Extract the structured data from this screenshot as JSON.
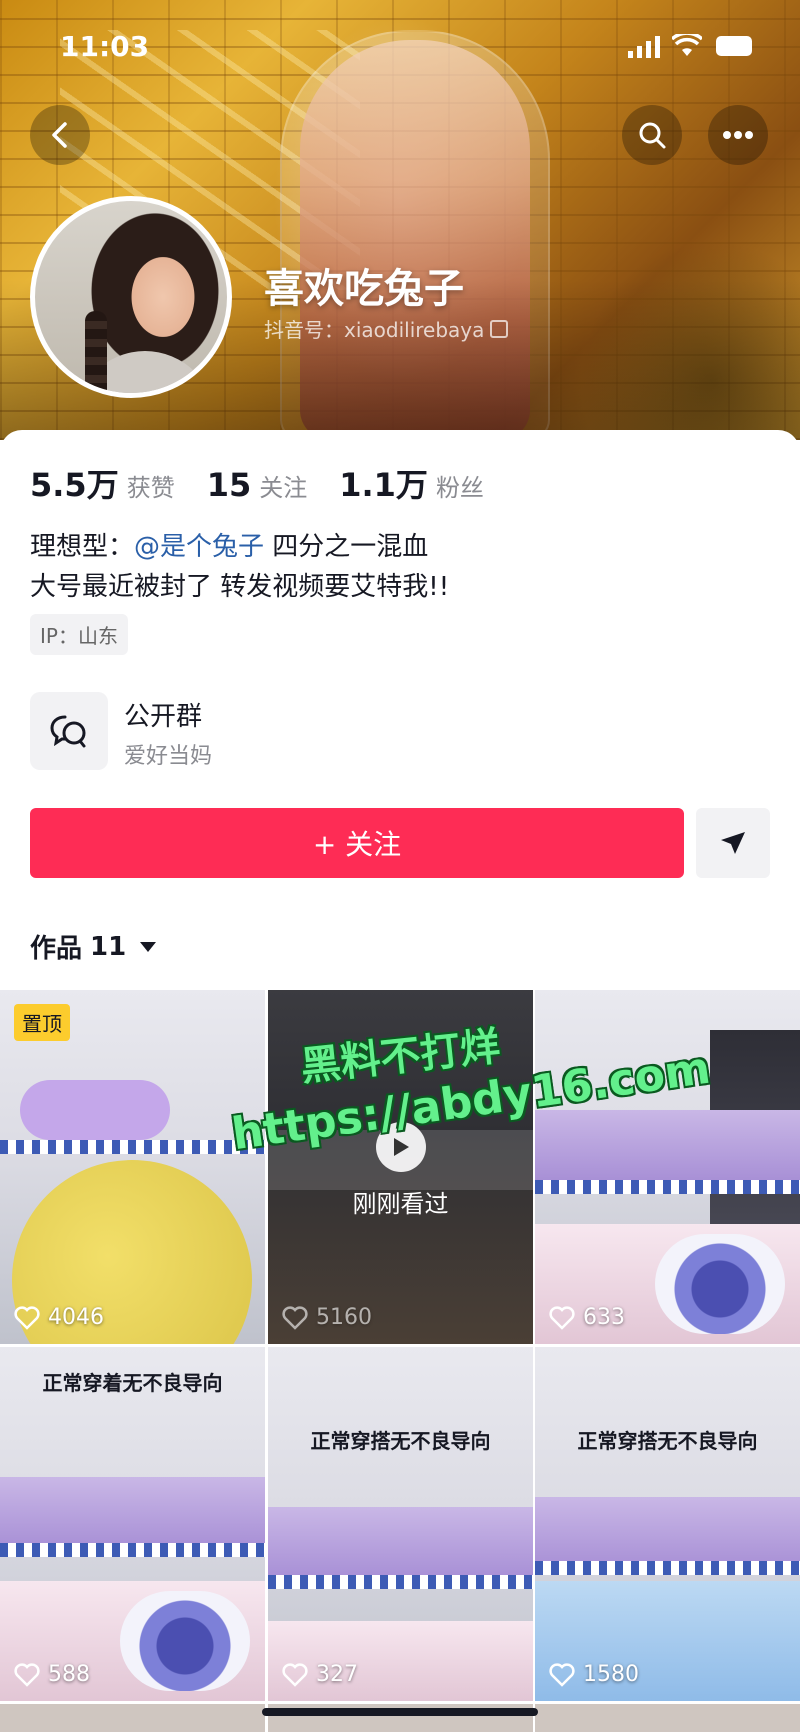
{
  "status_bar": {
    "time": "11:03"
  },
  "profile": {
    "name": "喜欢吃兔子",
    "douyin_id": "抖音号：xiaodilirebaya"
  },
  "stats": [
    {
      "value": "5.5万",
      "label": "获赞"
    },
    {
      "value": "15",
      "label": "关注"
    },
    {
      "value": "1.1万",
      "label": "粉丝"
    }
  ],
  "bio": {
    "line1_prefix": "理想型：",
    "mention": "@是个兔子",
    "line1_suffix": " 四分之一混血",
    "line2": "大号最近被封了  转发视频要艾特我!!",
    "ip": "IP：山东"
  },
  "group": {
    "title": "公开群",
    "subtitle": "爱好当妈"
  },
  "actions": {
    "follow_label": "+ 关注"
  },
  "works": {
    "label": "作品",
    "count": "11"
  },
  "videos": [
    {
      "badge": "置顶",
      "likes": "4046"
    },
    {
      "likes": "5160",
      "overlay": "刚刚看过"
    },
    {
      "likes": "633"
    },
    {
      "caption": "正常穿着无不良导向",
      "likes": "588"
    },
    {
      "caption": "正常穿搭无不良导向",
      "likes": "327"
    },
    {
      "caption": "正常穿搭无不良导向",
      "likes": "1580"
    }
  ],
  "watermark": {
    "line1": "黑料不打烊",
    "line2": "https://abdy16.com"
  },
  "colors": {
    "accent": "#fe2c55",
    "mention": "#2a5fa8",
    "badge": "#fccc2d",
    "watermark": "#63f08c"
  }
}
